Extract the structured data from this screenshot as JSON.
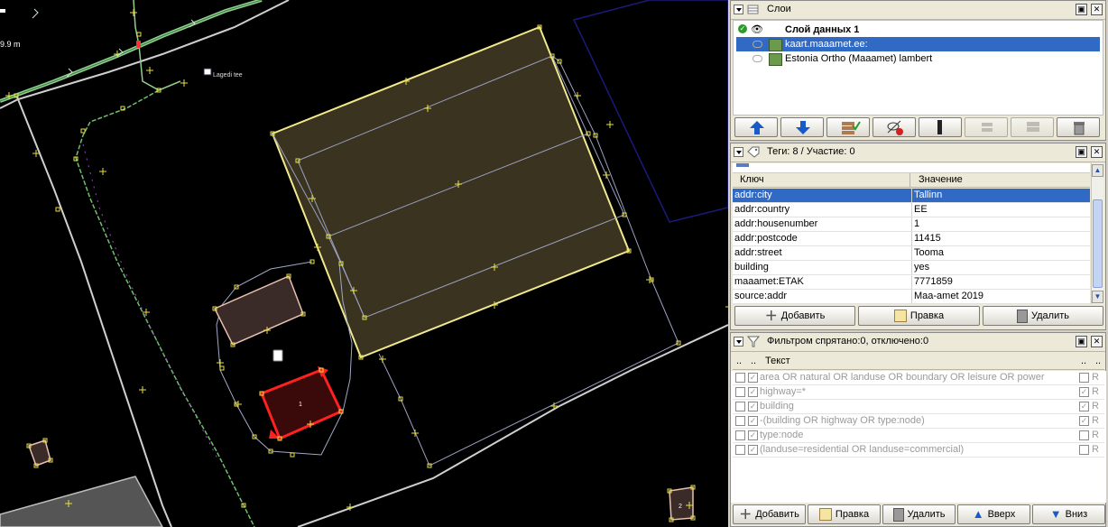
{
  "map": {
    "scale_label": "9.9 m",
    "poi_label": "Lagedi tee",
    "building_label_1": "1",
    "building_label_2": "2"
  },
  "layers_panel": {
    "title": "Слои",
    "layers": [
      {
        "name": "Слой данных 1",
        "bold": true,
        "selected": false
      },
      {
        "name": "kaart.maaamet.ee:",
        "bold": false,
        "selected": true
      },
      {
        "name": "Estonia Ortho (Maaamet) lambert",
        "bold": false,
        "selected": false
      }
    ],
    "buttons": [
      "move-up",
      "move-down",
      "merge",
      "toggle-visibility",
      "active",
      "merge-disabled",
      "duplicate-disabled",
      "delete"
    ]
  },
  "tags_panel": {
    "title": "Теги: 8 / Участие: 0",
    "col_key": "Ключ",
    "col_value": "Значение",
    "rows": [
      {
        "key": "addr:city",
        "value": "Tallinn",
        "selected": true
      },
      {
        "key": "addr:country",
        "value": "EE",
        "selected": false
      },
      {
        "key": "addr:housenumber",
        "value": "1",
        "selected": false
      },
      {
        "key": "addr:postcode",
        "value": "11415",
        "selected": false
      },
      {
        "key": "addr:street",
        "value": "Tooma",
        "selected": false
      },
      {
        "key": "building",
        "value": "yes",
        "selected": false
      },
      {
        "key": "maaamet:ETAK",
        "value": "7771859",
        "selected": false
      },
      {
        "key": "source:addr",
        "value": "Maa-amet 2019",
        "selected": false
      }
    ],
    "add_label": "Добавить",
    "edit_label": "Правка",
    "delete_label": "Удалить"
  },
  "filter_panel": {
    "title": "Фильтром спрятано:0, отключено:0",
    "col_dots_1": "..",
    "col_dots_2": "..",
    "col_text": "Текст",
    "col_dots_3": "..",
    "col_dots_4": "..",
    "rows": [
      {
        "text": "area OR natural OR landuse OR boundary OR leisure OR power",
        "r_checked": false
      },
      {
        "text": "highway=*",
        "r_checked": true
      },
      {
        "text": "building",
        "r_checked": true
      },
      {
        "text": "-(building OR highway OR type:node)",
        "r_checked": true
      },
      {
        "text": "type:node",
        "r_checked": false
      },
      {
        "text": "(landuse=residential OR landuse=commercial)",
        "r_checked": false
      }
    ],
    "r_label": "R",
    "add_label": "Добавить",
    "edit_label": "Правка",
    "delete_label": "Удалить",
    "up_label": "Вверх",
    "down_label": "Вниз"
  },
  "colors": {
    "selection_blue": "#316ac5",
    "panel_bg": "#ece9d8",
    "building_fill": "#3a3422",
    "building_outline": "#f0e68c",
    "selected_way": "#ff2020",
    "road_green": "#7fc07f",
    "node_yellow": "#e8e040"
  }
}
